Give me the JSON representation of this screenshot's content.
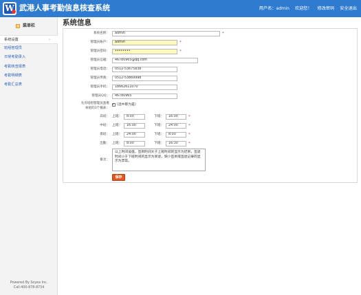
{
  "header": {
    "title": "武港人事考勤信息核查系统",
    "logo_letter": "W",
    "user_label": "用户名：",
    "user_name": "admin",
    "welcome": "欢迎您！",
    "change_password": "修改密码",
    "logout": "安全退出"
  },
  "sidebar": {
    "title": "菜单栏",
    "items": [
      {
        "label": "系统设置",
        "arrow": "›"
      },
      {
        "label": "班组管理员"
      },
      {
        "label": "日常考勤录入"
      },
      {
        "label": "考勤核查报表"
      },
      {
        "label": "考勤明细表"
      },
      {
        "label": "考勤汇总表"
      }
    ],
    "footer_line1": "Powered By Soyea Inc.",
    "footer_line2": "Call:400-878-8734"
  },
  "page_title": "系统信息",
  "form": {
    "system_name": {
      "label": "系统名称：",
      "value": "admin"
    },
    "admin_account": {
      "label": "管理员账户：",
      "value": "admin"
    },
    "admin_password": {
      "label": "管理员密码：",
      "value": "••••••••"
    },
    "admin_email": {
      "label": "管理员信箱：",
      "value": "46780965@qq.com"
    },
    "admin_phone": {
      "label": "管理员电话：",
      "value": "0512-53875838"
    },
    "admin_fax": {
      "label": "管理员传真：",
      "value": "0512-53869998"
    },
    "admin_mobile": {
      "label": "管理员手机：",
      "value": "18662611070"
    },
    "admin_qq": {
      "label": "管理员QQ：",
      "value": "46780965"
    },
    "allow_check": {
      "label_line1": "允许班组管理员查看",
      "label_line2": "本组的3个报表：",
      "checkbox_text": "(选中即为是)"
    },
    "on_label": "上班：",
    "off_label": "下班：",
    "required_mark": "*",
    "shifts": [
      {
        "label": "白班：",
        "on": "8:00",
        "off": "16:00"
      },
      {
        "label": "中班：",
        "on": "16:00",
        "off": "24:00"
      },
      {
        "label": "夜班：",
        "on": "24:00",
        "off": "8:00"
      },
      {
        "label": "出勤：",
        "on": "8:00",
        "off": "16:30"
      }
    ],
    "remark": {
      "label": "备注：",
      "value": "以上时间设值，签到时间大于上班时间的显示为迟到，签退时间小于下班时间的显示为早退，缺少签到或签退记录的显示为异常。"
    },
    "save_label": "保存"
  },
  "colors": {
    "header_bg": "#2f7bd0",
    "link": "#2f66b8",
    "required": "#e03030",
    "save_button": "#e3571e",
    "highlight_input": "#fafabf"
  }
}
